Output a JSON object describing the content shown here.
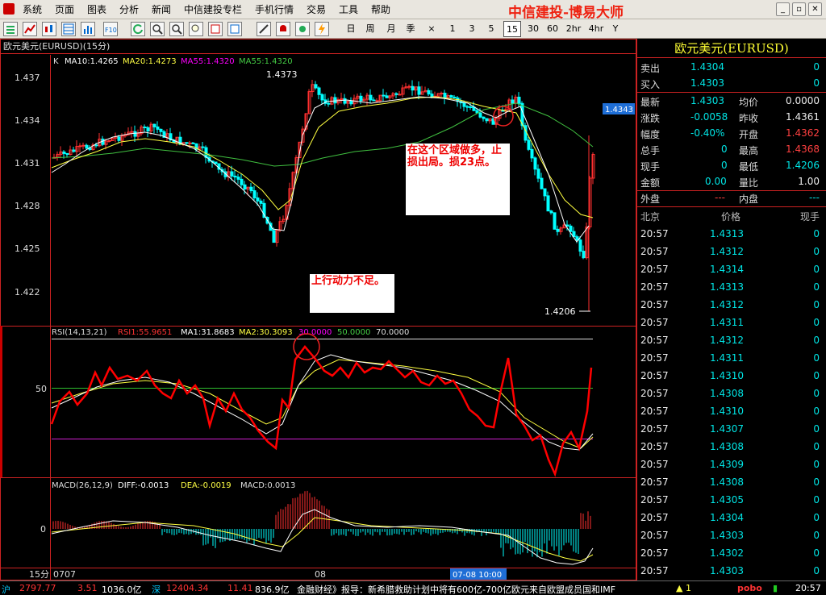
{
  "menu": {
    "items": [
      "系统",
      "页面",
      "图表",
      "分析",
      "新闻",
      "中信建投专栏",
      "手机行情",
      "交易",
      "工具",
      "帮助"
    ],
    "app_title": "中信建投-博易大师"
  },
  "toolbar": {
    "periods": [
      "日",
      "周",
      "月",
      "季",
      "×",
      "1",
      "3",
      "5",
      "15",
      "30",
      "60",
      "2hr",
      "4hr",
      "Y"
    ],
    "active_period": "15"
  },
  "chart": {
    "symbol_label": "欧元美元(EURUSD)(15分)",
    "legend": {
      "k": "K",
      "ma10": "MA10:1.4265",
      "ma20": "MA20:1.4273",
      "ma55a": "MA55:1.4320",
      "ma55b": "MA55:1.4320"
    },
    "price_axis": [
      "1.437",
      "1.434",
      "1.431",
      "1.428",
      "1.425",
      "1.422"
    ],
    "high_label": "1.4373",
    "low_label": "1.4206",
    "last_price": "1.4343",
    "rsi_legend": {
      "title": "RSI(14,13,21)",
      "rsi1": "RSI1:55.9651",
      "ma1": "MA1:31.8683",
      "ma2": "MA2:30.3093",
      "l30": "30.0000",
      "l50": "50.0000",
      "l70": "70.0000"
    },
    "rsi_axis": "50",
    "macd_legend": {
      "title": "MACD(26,12,9)",
      "diff": "DIFF:-0.0013",
      "dea": "DEA:-0.0019",
      "macd": "MACD:0.0013"
    },
    "macd_axis": "0",
    "time_axis": {
      "period": "15分",
      "start": "0707",
      "mid": "08",
      "cursor": "07-08 10:00"
    },
    "annotation1": "在这个区域做多，止损出局。损23点。",
    "annotation2": "上行动力不足。",
    "colors": {
      "up": "#ff3030",
      "down": "#00ffff",
      "ma10": "#ffffff",
      "ma20": "#ffff40",
      "ma55": "#40c040",
      "rsi": "#ff0000"
    }
  },
  "quote": {
    "title": "欧元美元(EURUSD)",
    "sell": {
      "label": "卖出",
      "price": "1.4304",
      "vol": "0"
    },
    "buy": {
      "label": "买入",
      "price": "1.4303",
      "vol": "0"
    },
    "rows": [
      {
        "l1": "最新",
        "v1": "1.4303",
        "l2": "均价",
        "v2": "0.0000"
      },
      {
        "l1": "涨跌",
        "v1": "-0.0058",
        "l2": "昨收",
        "v2": "1.4361"
      },
      {
        "l1": "幅度",
        "v1": "-0.40%",
        "l2": "开盘",
        "v2": "1.4362"
      },
      {
        "l1": "总手",
        "v1": "0",
        "l2": "最高",
        "v2": "1.4368"
      },
      {
        "l1": "现手",
        "v1": "0",
        "l2": "最低",
        "v2": "1.4206"
      },
      {
        "l1": "金额",
        "v1": "0.00",
        "l2": "量比",
        "v2": "1.00"
      },
      {
        "l1": "外盘",
        "v1": "---",
        "l2": "内盘",
        "v2": "---"
      }
    ],
    "ticks_header": {
      "time": "北京",
      "price": "价格",
      "vol": "现手"
    },
    "ticks": [
      {
        "time": "20:57",
        "price": "1.4313",
        "vol": "0"
      },
      {
        "time": "20:57",
        "price": "1.4312",
        "vol": "0"
      },
      {
        "time": "20:57",
        "price": "1.4314",
        "vol": "0"
      },
      {
        "time": "20:57",
        "price": "1.4313",
        "vol": "0"
      },
      {
        "time": "20:57",
        "price": "1.4312",
        "vol": "0"
      },
      {
        "time": "20:57",
        "price": "1.4311",
        "vol": "0"
      },
      {
        "time": "20:57",
        "price": "1.4312",
        "vol": "0"
      },
      {
        "time": "20:57",
        "price": "1.4311",
        "vol": "0"
      },
      {
        "time": "20:57",
        "price": "1.4310",
        "vol": "0"
      },
      {
        "time": "20:57",
        "price": "1.4308",
        "vol": "0"
      },
      {
        "time": "20:57",
        "price": "1.4310",
        "vol": "0"
      },
      {
        "time": "20:57",
        "price": "1.4307",
        "vol": "0"
      },
      {
        "time": "20:57",
        "price": "1.4308",
        "vol": "0"
      },
      {
        "time": "20:57",
        "price": "1.4309",
        "vol": "0"
      },
      {
        "time": "20:57",
        "price": "1.4308",
        "vol": "0"
      },
      {
        "time": "20:57",
        "price": "1.4305",
        "vol": "0"
      },
      {
        "time": "20:57",
        "price": "1.4304",
        "vol": "0"
      },
      {
        "time": "20:57",
        "price": "1.4303",
        "vol": "0"
      },
      {
        "time": "20:57",
        "price": "1.4302",
        "vol": "0"
      },
      {
        "time": "20:57",
        "price": "1.4303",
        "vol": "0"
      }
    ]
  },
  "status": {
    "sh_label": "沪",
    "sh_index": "2797.77",
    "sh_change": "3.51",
    "sh_amount": "1036.0亿",
    "sz_label": "深",
    "sz_index": "12404.34",
    "sz_change": "11.41",
    "sz_amount": "836.9亿",
    "news": "金融财经》报导：新希腊救助计划中将有600亿-700亿欧元来自欧盟成员国和IMF",
    "alert": "1",
    "brand": "pobo",
    "clock": "20:57"
  }
}
